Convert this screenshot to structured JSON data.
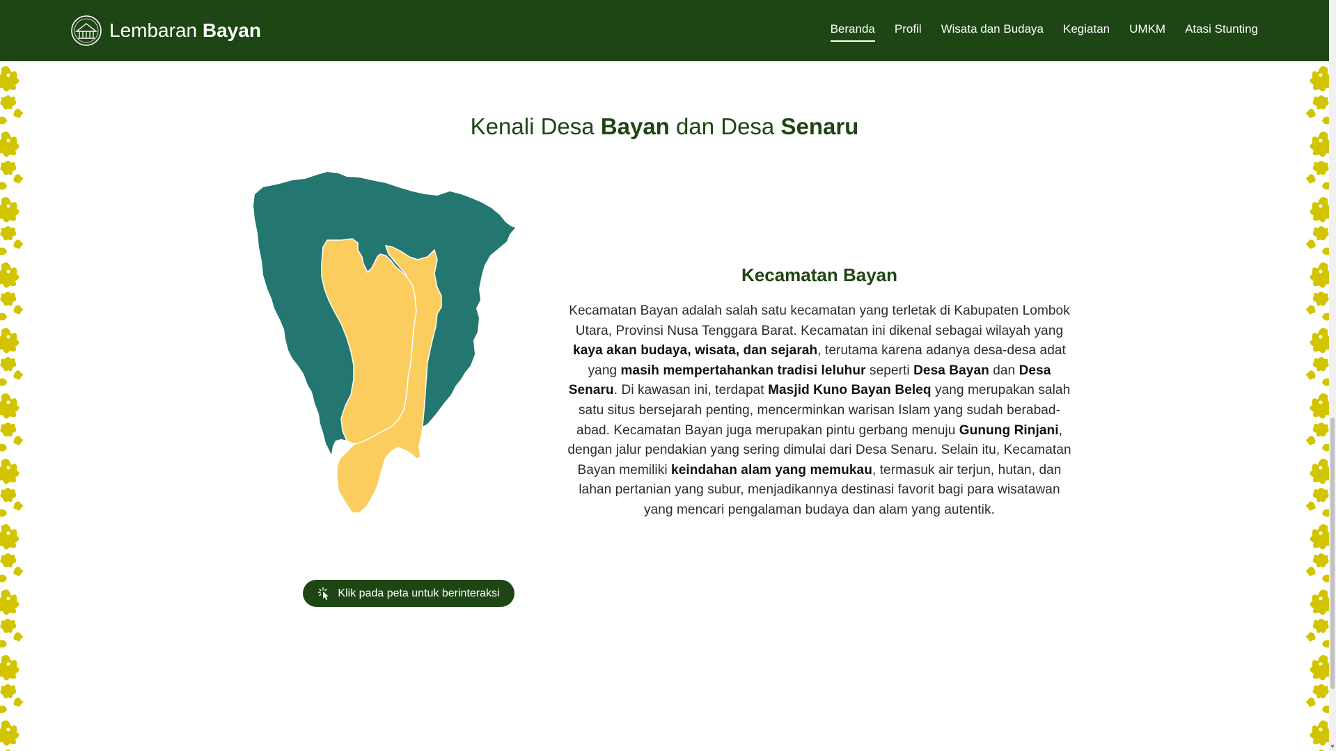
{
  "header": {
    "brand": {
      "name_regular": "Lembaran",
      "name_bold": "Bayan",
      "logo_icon": "village-emblem-icon"
    },
    "nav": [
      {
        "label": "Beranda",
        "active": true
      },
      {
        "label": "Profil",
        "active": false
      },
      {
        "label": "Wisata dan Budaya",
        "active": false
      },
      {
        "label": "Kegiatan",
        "active": false
      },
      {
        "label": "UMKM",
        "active": false
      },
      {
        "label": "Atasi Stunting",
        "active": false
      }
    ]
  },
  "section": {
    "title_part1": "Kenali Desa ",
    "title_bold1": "Bayan",
    "title_part2": " dan Desa ",
    "title_bold2": "Senaru"
  },
  "map": {
    "regions": [
      "Kecamatan Bayan",
      "Desa Bayan",
      "Desa Senaru"
    ],
    "hint_label": "Klik pada peta untuk berinteraksi",
    "hint_icon": "pointer-click-icon"
  },
  "info": {
    "heading": "Kecamatan Bayan",
    "p": [
      "Kecamatan Bayan adalah salah satu kecamatan yang terletak di Kabupaten Lombok Utara, Provinsi Nusa Tenggara Barat. Kecamatan ini dikenal sebagai wilayah yang ",
      "kaya akan budaya, wisata, dan sejarah",
      ", terutama karena adanya desa-desa adat yang ",
      "masih mempertahankan tradisi leluhur",
      " seperti ",
      "Desa Bayan",
      " dan ",
      "Desa Senaru",
      ". Di kawasan ini, terdapat ",
      "Masjid Kuno Bayan Beleq",
      " yang merupakan salah satu situs bersejarah penting, mencerminkan warisan Islam yang sudah berabad-abad. Kecamatan Bayan juga merupakan pintu gerbang menuju ",
      "Gunung Rinjani",
      ", dengan jalur pendakian yang sering dimulai dari Desa Senaru. Selain itu, Kecamatan Bayan memiliki ",
      "keindahan alam yang memukau",
      ", termasuk air terjun, hutan, dan lahan pertanian yang subur, menjadikannya destinasi favorit bagi para wisatawan yang mencari pengalaman budaya dan alam yang autentik."
    ]
  },
  "colors": {
    "primary": "#1e4514",
    "map_district": "#247670",
    "map_village": "#fbcd5f",
    "ornament": "#d3c400"
  }
}
